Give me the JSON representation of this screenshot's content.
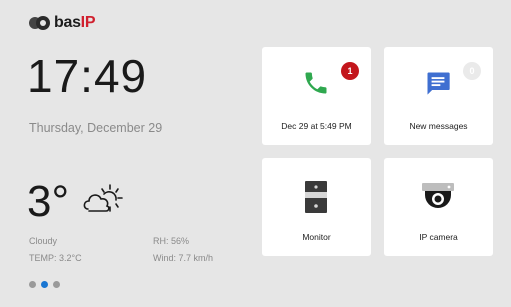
{
  "logo": {
    "text": "bas",
    "suffix": "IP"
  },
  "clock": {
    "time": "17:49",
    "date": "Thursday, December 29"
  },
  "weather": {
    "temperature": "3°",
    "icon": "cloudy-sun-icon",
    "condition": "Cloudy",
    "humidity": "RH: 56%",
    "temp_detail": "TEMP: 3.2°C",
    "wind": "Wind: 7.7 km/h"
  },
  "pagination": {
    "count": 3,
    "active_index": 1,
    "active_color": "#1976d2"
  },
  "tiles": [
    {
      "label": "Dec 29 at 5:49 PM",
      "icon": "phone-icon",
      "badge": "1",
      "icon_color": "#2fa84f",
      "badge_color": "#c3161c"
    },
    {
      "label": "New messages",
      "icon": "message-icon",
      "badge": "0",
      "icon_color": "#3f6fd1"
    },
    {
      "label": "Monitor",
      "icon": "intercom-panel-icon"
    },
    {
      "label": "IP camera",
      "icon": "dome-camera-icon"
    }
  ]
}
